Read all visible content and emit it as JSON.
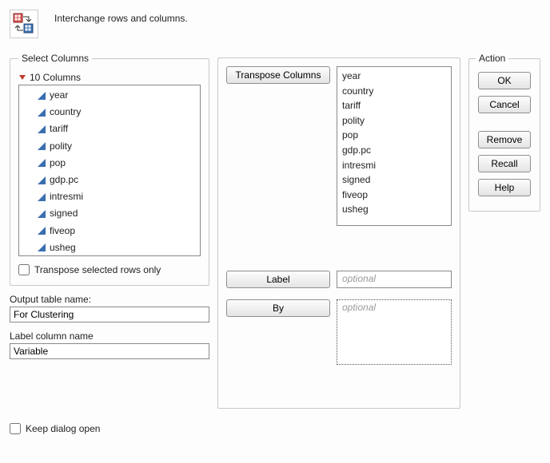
{
  "header": {
    "description": "Interchange rows and columns."
  },
  "select_columns": {
    "legend": "Select Columns",
    "count_label": "10 Columns",
    "columns": [
      "year",
      "country",
      "tariff",
      "polity",
      "pop",
      "gdp.pc",
      "intresmi",
      "signed",
      "fiveop",
      "usheg"
    ],
    "transpose_rows_only_label": "Transpose selected rows only",
    "transpose_rows_only_checked": false
  },
  "output_table": {
    "label": "Output table name:",
    "value": "For Clustering"
  },
  "label_column": {
    "label": "Label column name",
    "value": "Variable"
  },
  "roles": {
    "transpose": {
      "button": "Transpose Columns",
      "items": [
        "year",
        "country",
        "tariff",
        "polity",
        "pop",
        "gdp.pc",
        "intresmi",
        "signed",
        "fiveop",
        "usheg"
      ]
    },
    "label_role": {
      "button": "Label",
      "placeholder": "optional"
    },
    "by_role": {
      "button": "By",
      "placeholder": "optional"
    }
  },
  "actions": {
    "legend": "Action",
    "ok": "OK",
    "cancel": "Cancel",
    "remove": "Remove",
    "recall": "Recall",
    "help": "Help"
  },
  "footer": {
    "keep_open_label": "Keep dialog open",
    "keep_open_checked": false
  }
}
